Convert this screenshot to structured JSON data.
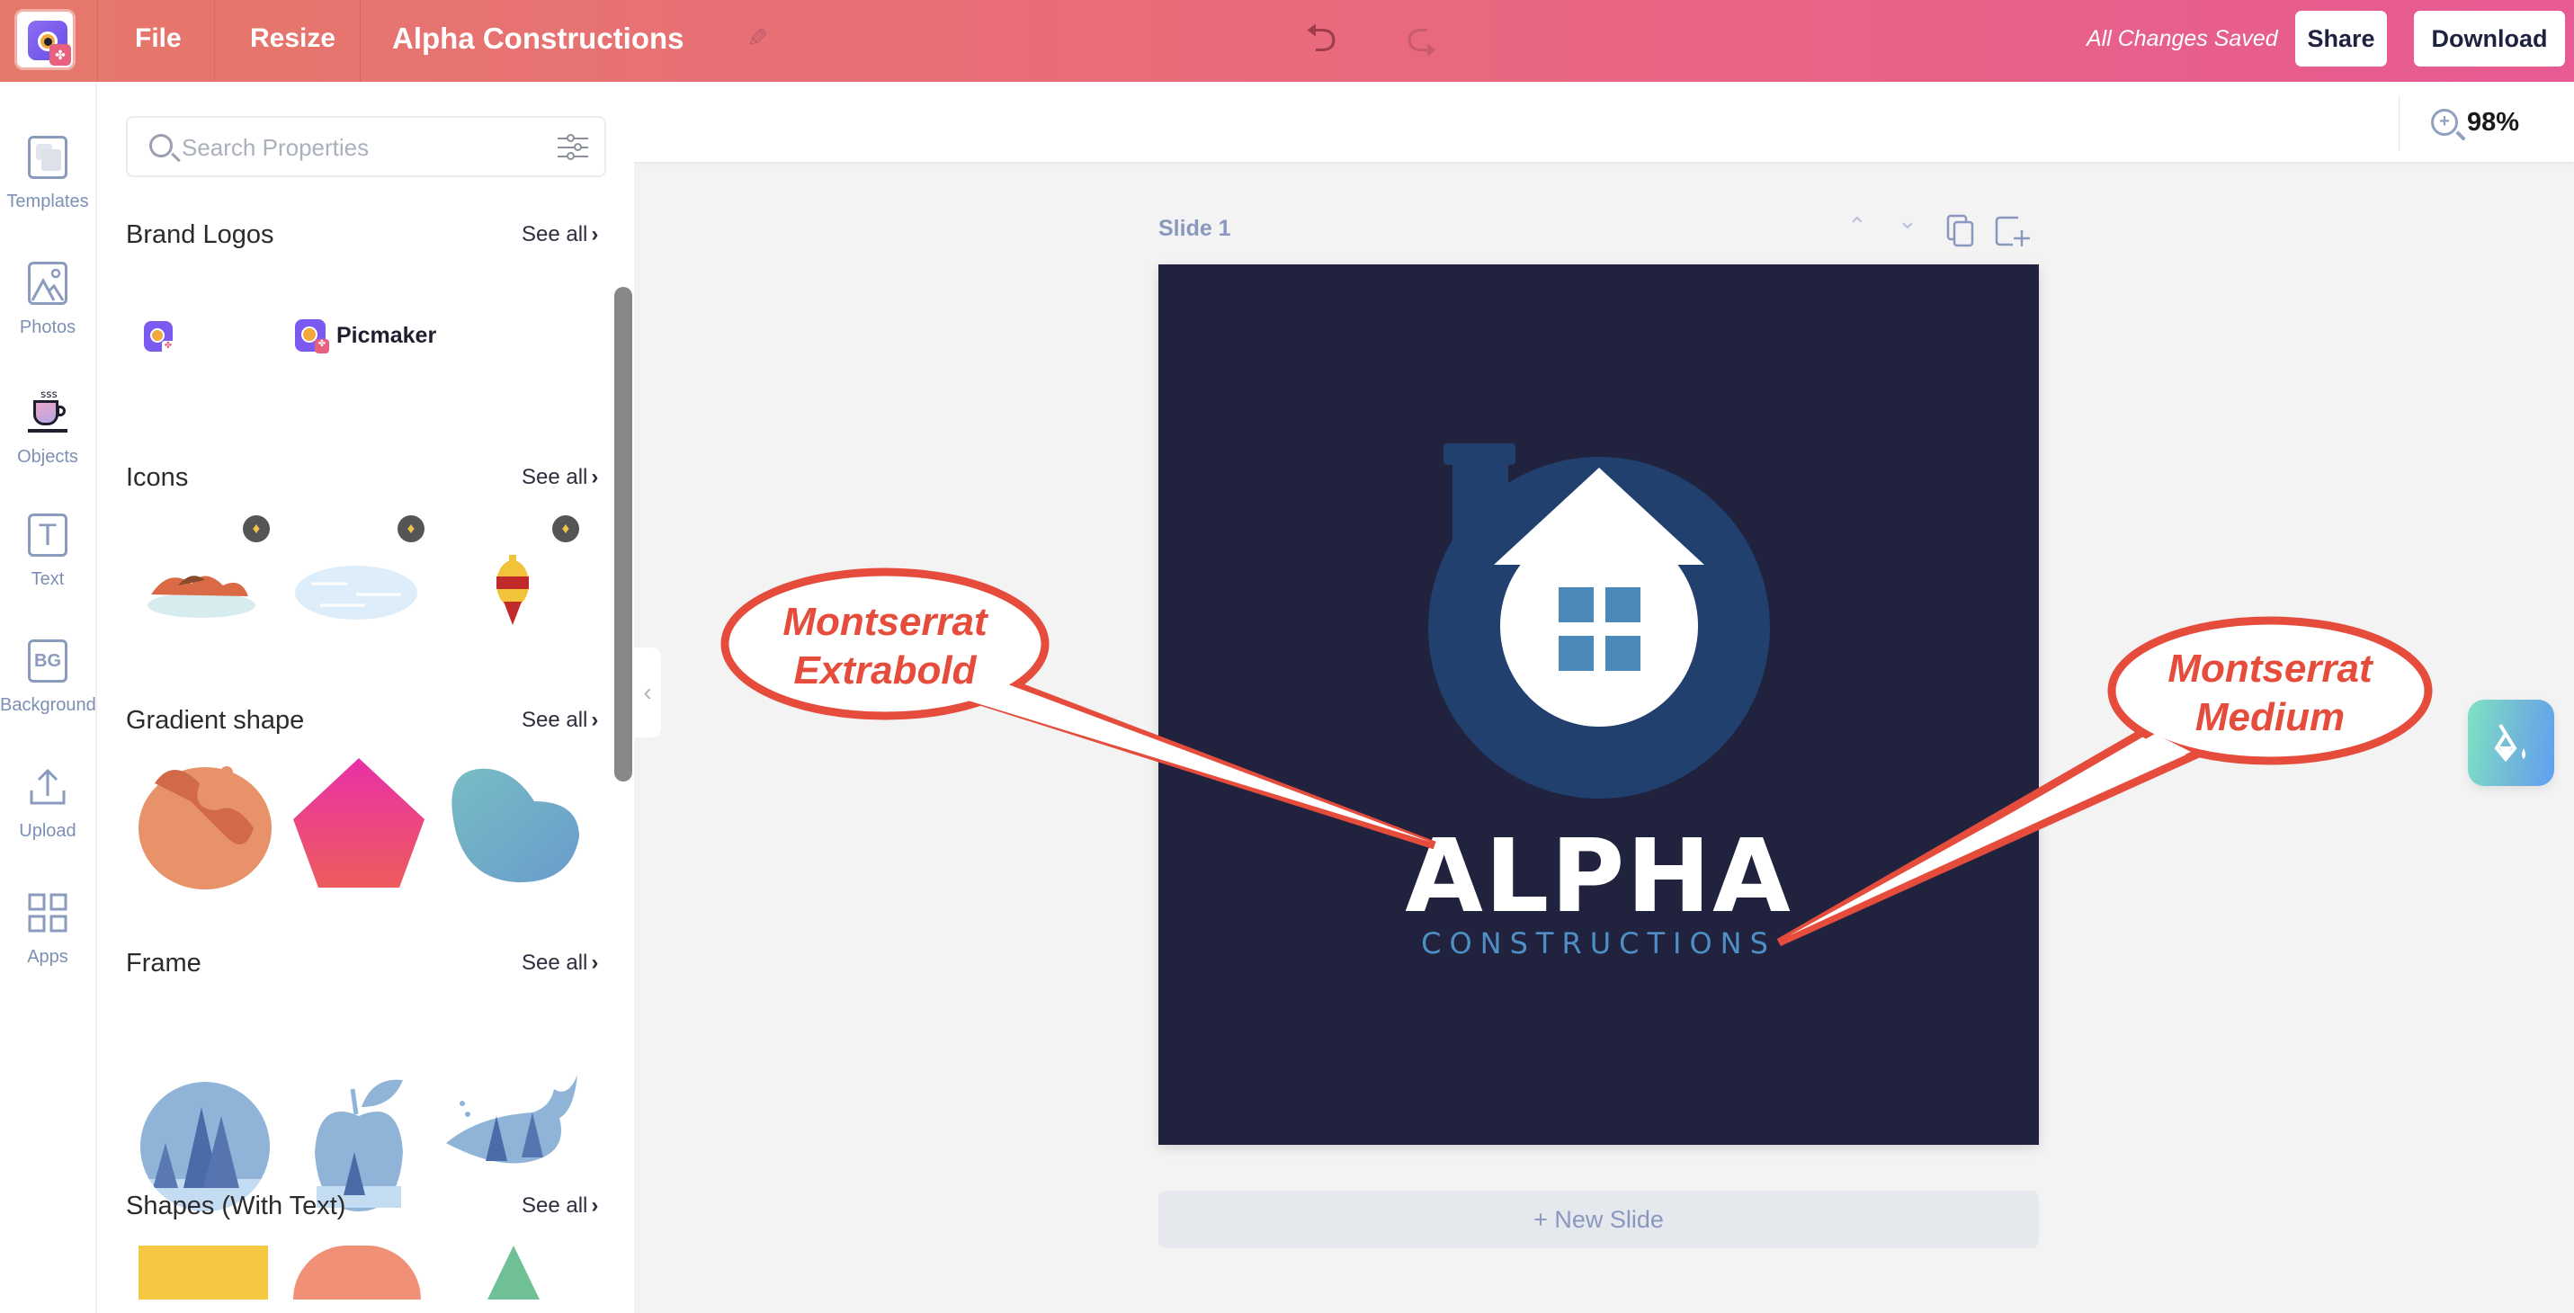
{
  "header": {
    "file_label": "File",
    "resize_label": "Resize",
    "doc_title": "Alpha Constructions",
    "status": "All Changes Saved",
    "share_label": "Share",
    "download_label": "Download",
    "colors": {
      "gradient_start": "#e6786a",
      "gradient_end": "#e75a93"
    }
  },
  "toolbar": {
    "zoom_level": "98%"
  },
  "sidebar": {
    "items": [
      {
        "label": "Templates",
        "icon": "templates-icon"
      },
      {
        "label": "Photos",
        "icon": "photo-icon"
      },
      {
        "label": "Objects",
        "icon": "objects-cup-icon"
      },
      {
        "label": "Text",
        "icon": "text-icon"
      },
      {
        "label": "Background",
        "icon": "background-icon",
        "glyph": "BG"
      },
      {
        "label": "Upload",
        "icon": "upload-icon"
      },
      {
        "label": "Apps",
        "icon": "apps-grid-icon"
      }
    ]
  },
  "panel": {
    "search_placeholder": "Search Properties",
    "see_all": "See all",
    "sections": [
      {
        "title": "Brand Logos",
        "items": [
          "brand-logo-icon-only",
          "brand-logo-with-name"
        ],
        "logo_name": "Picmaker"
      },
      {
        "title": "Icons",
        "items": [
          "roast-food-icon",
          "cloud-icon",
          "ornament-icon"
        ],
        "premium": true
      },
      {
        "title": "Gradient shape",
        "items": [
          "orange-blob",
          "pink-pentagon",
          "teal-blob"
        ]
      },
      {
        "title": "Frame",
        "items": [
          "circle-forest-frame",
          "apple-forest-frame",
          "whale-forest-frame"
        ]
      },
      {
        "title": "Shapes (With Text)",
        "items": [
          "yellow-rectangle",
          "salmon-semicircle",
          "green-triangle"
        ]
      }
    ]
  },
  "canvas": {
    "slide_label": "Slide 1",
    "new_slide_label": "+ New Slide",
    "logo_title": "ALPHA",
    "logo_subtitle": "CONSTRUCTIONS",
    "colors": {
      "slide_bg": "#20223e",
      "circle": "#21406e",
      "window": "#4a89b9",
      "subtitle": "#4e8fc5"
    }
  },
  "annotations": [
    {
      "line1": "Montserrat",
      "line2": "Extrabold",
      "target": "ALPHA"
    },
    {
      "line1": "Montserrat",
      "line2": "Medium",
      "target": "CONSTRUCTIONS"
    }
  ],
  "annotation_color": "#e64c3c"
}
